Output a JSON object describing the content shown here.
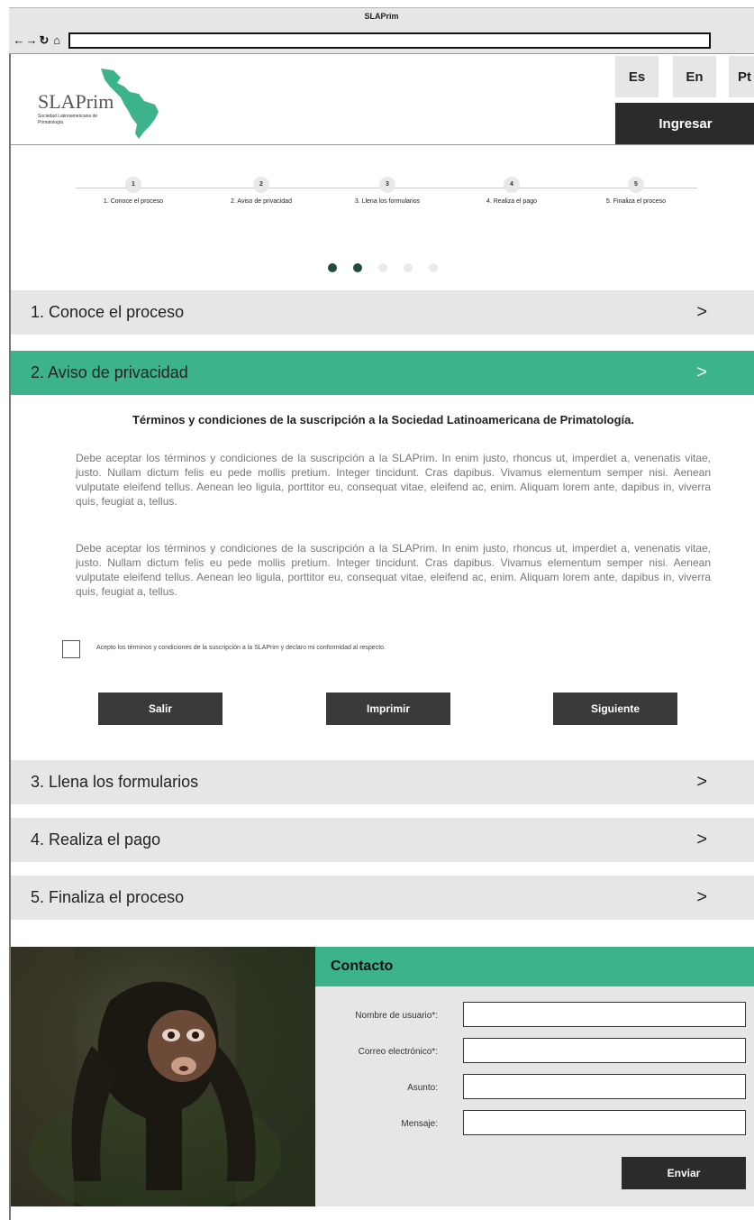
{
  "browser": {
    "title": "SLAPrim",
    "nav": [
      "←",
      "→",
      "↻",
      "⌂"
    ],
    "address": ""
  },
  "header": {
    "logo_name": "SLAPrim",
    "logo_sub": "Sociedad Latinoamericana de Primatología",
    "languages": [
      "Es",
      "En",
      "Pt"
    ],
    "login": "Ingresar"
  },
  "steps": [
    {
      "num": "1",
      "label": "1. Conoce el proceso"
    },
    {
      "num": "2",
      "label": "2. Aviso de privacidad"
    },
    {
      "num": "3",
      "label": "3. Llena los formularios"
    },
    {
      "num": "4",
      "label": "4. Realiza el pago"
    },
    {
      "num": "5",
      "label": "5. Finaliza el proceso"
    }
  ],
  "progress": {
    "completed": 2,
    "total": 5
  },
  "sections": [
    {
      "label": "1. Conoce el proceso",
      "chevron": ">"
    },
    {
      "label": "2. Aviso de privacidad",
      "chevron": ">"
    },
    {
      "label": "3. Llena los formularios",
      "chevron": ">"
    },
    {
      "label": "4. Realiza el pago",
      "chevron": ">"
    },
    {
      "label": "5. Finaliza el proceso",
      "chevron": ">"
    }
  ],
  "terms": {
    "title": "Términos y condiciones de la suscripción a la Sociedad Latinoamericana de Primatología.",
    "paragraphs": [
      "Debe aceptar los términos y condiciones de la suscripción a la SLAPrim. In enim justo, rhoncus ut, imperdiet a, venenatis vitae, justo. Nullam dictum felis eu pede mollis pretium. Integer tincidunt. Cras dapibus. Vivamus elementum semper nisi. Aenean vulputate eleifend tellus. Aenean leo ligula, porttitor eu, consequat vitae, eleifend ac, enim. Aliquam lorem ante, dapibus in, viverra quis, feugiat a, tellus.",
      "Debe aceptar los términos y condiciones de la suscripción a la SLAPrim. In enim justo, rhoncus ut, imperdiet a, venenatis vitae, justo. Nullam dictum felis eu pede mollis pretium. Integer tincidunt. Cras dapibus. Vivamus elementum semper nisi. Aenean vulputate eleifend tellus. Aenean leo ligula, porttitor eu, consequat vitae, eleifend ac, enim. Aliquam lorem ante, dapibus in, viverra quis, feugiat a, tellus."
    ],
    "checkbox_label": "Acepto los términos y condiciones de la suscripción a la SLAPrim y declaro mi conformidad al respecto.",
    "checked": false,
    "buttons": {
      "exit": "Salir",
      "print": "Imprimir",
      "next": "Siguiente"
    }
  },
  "contact": {
    "title": "Contacto",
    "fields": [
      {
        "label": "Nombre de usuario*:",
        "value": ""
      },
      {
        "label": "Correo electrónico*:",
        "value": ""
      },
      {
        "label": "Asunto:",
        "value": ""
      },
      {
        "label": "Mensaje:",
        "value": ""
      }
    ],
    "submit": "Enviar"
  },
  "colors": {
    "accent": "#3db38c",
    "dark": "#2b2b2b",
    "panel": "#e6e6e6",
    "dot_active": "#1f4a40"
  }
}
